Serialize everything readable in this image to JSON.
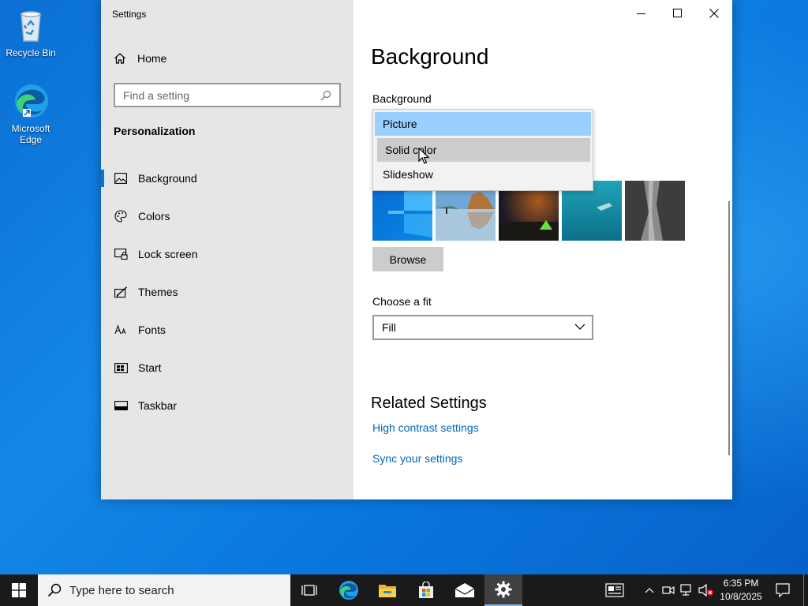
{
  "desktop": {
    "icons": [
      {
        "label": "Recycle Bin"
      },
      {
        "label": "Microsoft Edge"
      }
    ]
  },
  "window": {
    "title": "Settings",
    "nav": {
      "home_label": "Home",
      "search_placeholder": "Find a setting",
      "section_title": "Personalization",
      "items": [
        {
          "label": "Background",
          "icon": "picture-icon",
          "active": true
        },
        {
          "label": "Colors",
          "icon": "palette-icon",
          "active": false
        },
        {
          "label": "Lock screen",
          "icon": "lock-screen-icon",
          "active": false
        },
        {
          "label": "Themes",
          "icon": "brush-icon",
          "active": false
        },
        {
          "label": "Fonts",
          "icon": "font-icon",
          "active": false
        },
        {
          "label": "Start",
          "icon": "start-icon",
          "active": false
        },
        {
          "label": "Taskbar",
          "icon": "taskbar-icon",
          "active": false
        }
      ]
    },
    "main": {
      "page_title": "Background",
      "background_label": "Background",
      "dropdown": {
        "options": [
          "Picture",
          "Solid color",
          "Slideshow"
        ],
        "selected": "Picture",
        "hovered": "Solid color"
      },
      "browse_label": "Browse",
      "fit_label": "Choose a fit",
      "fit_value": "Fill",
      "related_title": "Related Settings",
      "links": [
        "High contrast settings",
        "Sync your settings"
      ]
    }
  },
  "taskbar": {
    "search_placeholder": "Type here to search",
    "time": "6:35 PM",
    "date": "10/8/2025",
    "apps": [
      "task-view",
      "edge",
      "file-explorer",
      "store",
      "mail",
      "settings"
    ],
    "active_app": "settings"
  },
  "colors": {
    "accent": "#0078d7",
    "selected_item": "#99d0ff",
    "hover_item": "#cccccc",
    "link": "#0067b8"
  }
}
